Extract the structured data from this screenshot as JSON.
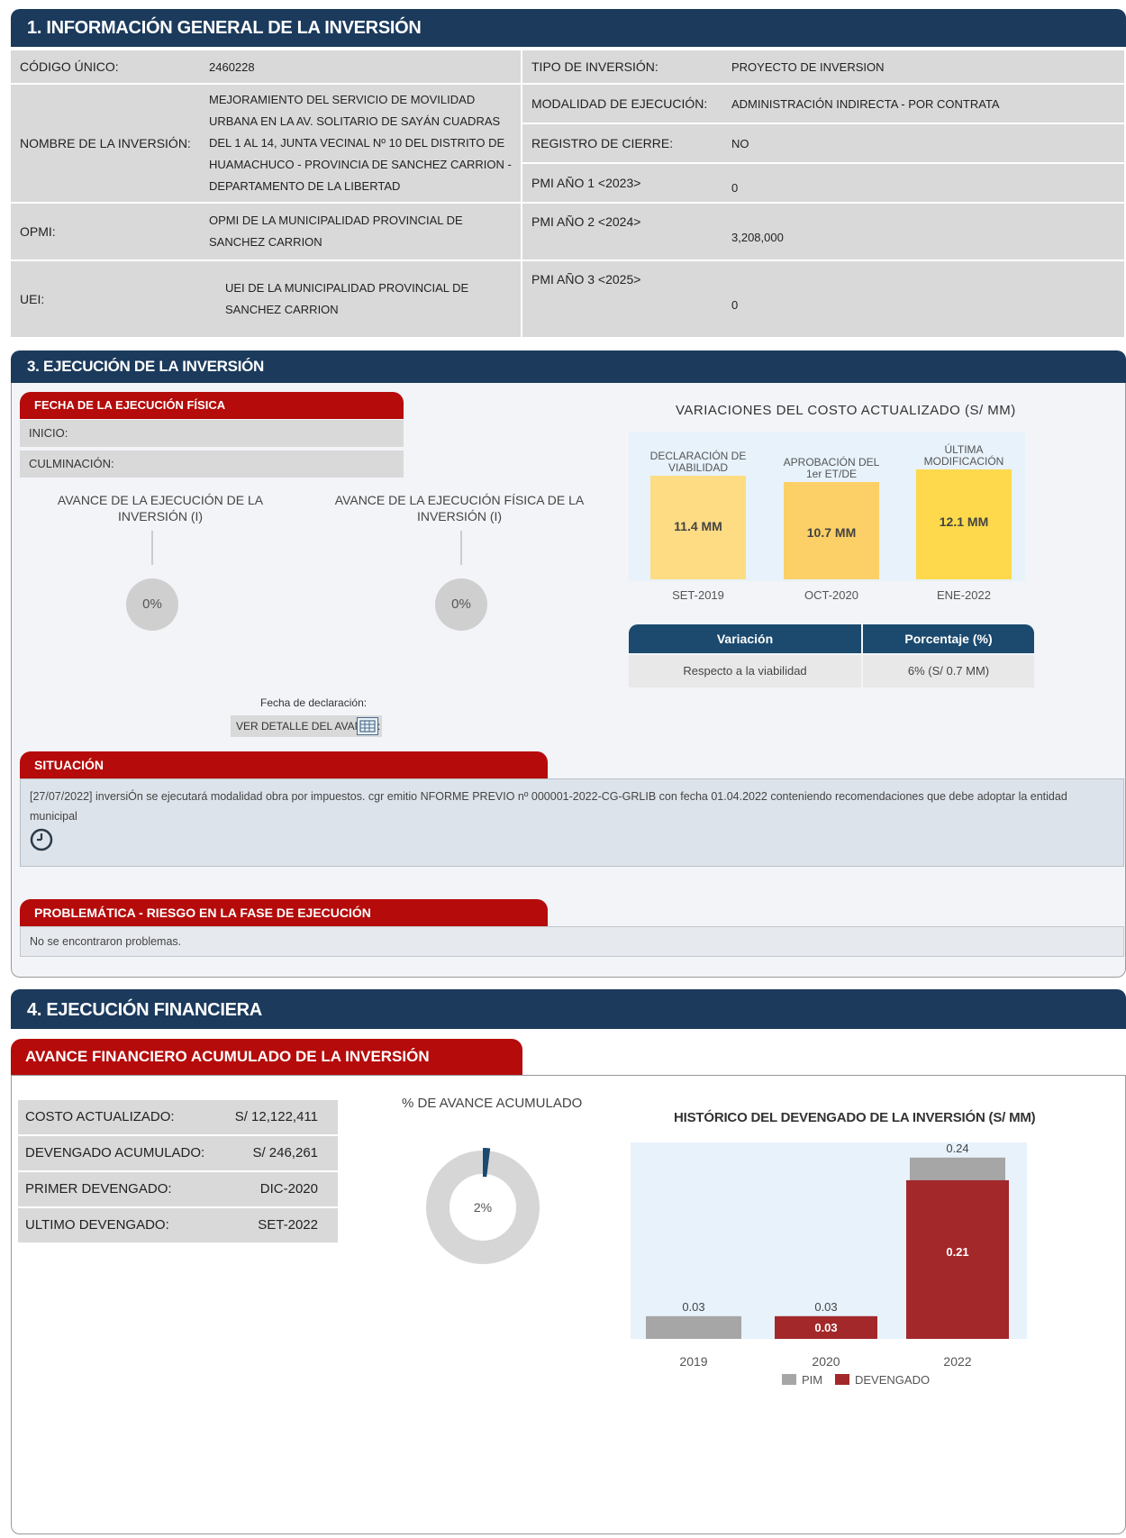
{
  "section1": {
    "title": "1. INFORMACIÓN GENERAL DE LA INVERSIÓN",
    "codigo_label": "CÓDIGO ÚNICO:",
    "codigo_value": "2460228",
    "nombre_label": "NOMBRE DE LA INVERSIÓN:",
    "nombre_value": "MEJORAMIENTO DEL SERVICIO DE MOVILIDAD URBANA EN LA AV. SOLITARIO DE SAYÁN CUADRAS DEL 1 AL 14, JUNTA VECINAL Nº 10 DEL DISTRITO DE HUAMACHUCO - PROVINCIA DE SANCHEZ CARRION - DEPARTAMENTO DE LA LIBERTAD",
    "opmi_label": "OPMI:",
    "opmi_value": "OPMI DE LA MUNICIPALIDAD PROVINCIAL DE SANCHEZ CARRION",
    "uei_label": "UEI:",
    "uei_value": "UEI DE LA MUNICIPALIDAD PROVINCIAL DE SANCHEZ CARRION",
    "tipo_label": "TIPO DE INVERSIÓN:",
    "tipo_value": "PROYECTO DE INVERSION",
    "modalidad_label": "MODALIDAD DE EJECUCIÓN:",
    "modalidad_value": "ADMINISTRACIÓN INDIRECTA - POR CONTRATA",
    "registro_label": "REGISTRO DE CIERRE:",
    "registro_value": "NO",
    "pmi1_label": "PMI AÑO 1 <2023>",
    "pmi1_value": "0",
    "pmi2_label": "PMI AÑO 2 <2024>",
    "pmi2_value": "3,208,000",
    "pmi3_label": "PMI AÑO 3 <2025>",
    "pmi3_value": "0"
  },
  "section3": {
    "title": "3. EJECUCIÓN DE LA INVERSIÓN",
    "fecha_tab": "FECHA DE LA EJECUCIÓN FÍSICA",
    "inicio_label": "INICIO:",
    "culminacion_label": "CULMINACIÓN:",
    "avance_inv_title": "AVANCE DE LA EJECUCIÓN DE LA INVERSIÓN (I)",
    "avance_inv_value": "0%",
    "avance_fis_title": "AVANCE DE LA EJECUCIÓN FÍSICA DE LA INVERSIÓN (I)",
    "avance_fis_value": "0%",
    "variaciones_title": "VARIACIONES DEL COSTO ACTUALIZADO (S/ MM)",
    "fecha_declaracion": "Fecha de declaración:",
    "ver_detalle": "VER DETALLE DEL AVANCE:",
    "variacion_header": "Variación",
    "porcentaje_header": "Porcentaje (%)",
    "variacion_row": "Respecto a la viabilidad",
    "porcentaje_row": "6% (S/ 0.7 MM)",
    "situacion_tab": "SITUACIÓN",
    "situacion_text": "[27/07/2022] inversiÓn se ejecutará modalidad obra por impuestos. cgr emitio NFORME PREVIO nº 000001-2022-CG-GRLIB con fecha 01.04.2022 conteniendo recomendaciones que debe adoptar la entidad municipal",
    "problematica_tab": "PROBLEMÁTICA - RIESGO EN LA FASE DE EJECUCIÓN",
    "problematica_text": "No se encontraron problemas."
  },
  "section4": {
    "title": "4. EJECUCIÓN FINANCIERA",
    "avance_tab": "AVANCE FINANCIERO ACUMULADO DE LA INVERSIÓN",
    "costo_label": "COSTO ACTUALIZADO:",
    "costo_value": "S/ 12,122,411",
    "devengado_label": "DEVENGADO ACUMULADO:",
    "devengado_value": "S/ 246,261",
    "primer_label": "PRIMER DEVENGADO:",
    "primer_value": "DIC-2020",
    "ultimo_label": "ULTIMO DEVENGADO:",
    "ultimo_value": "SET-2022",
    "donut_title": "% DE AVANCE ACUMULADO",
    "donut_value": "2%",
    "hist_title": "HISTÓRICO DEL DEVENGADO DE LA INVERSIÓN (S/ MM)"
  },
  "chart_data": [
    {
      "type": "bar",
      "title": "VARIACIONES DEL COSTO ACTUALIZADO (S/ MM)",
      "categories": [
        "DECLARACIÓN DE VIABILIDAD",
        "APROBACIÓN DEL 1er ET/DE",
        "ÚLTIMA MODIFICACIÓN"
      ],
      "dates": [
        "SET-2019",
        "OCT-2020",
        "ENE-2022"
      ],
      "values": [
        11.4,
        10.7,
        12.1
      ],
      "value_labels": [
        "11.4 MM",
        "10.7 MM",
        "12.1 MM"
      ],
      "colors": [
        "#fddc84",
        "#fcd067",
        "#fdd94b"
      ]
    },
    {
      "type": "donut",
      "title": "% DE AVANCE ACUMULADO",
      "values": [
        2
      ],
      "value_label": "2%",
      "colors": [
        "#1b4a6e",
        "#d6d6d6"
      ]
    },
    {
      "type": "bar",
      "title": "HISTÓRICO DEL DEVENGADO DE LA INVERSIÓN (S/ MM)",
      "categories": [
        "2019",
        "2020",
        "2022"
      ],
      "series": [
        {
          "name": "PIM",
          "values": [
            0.03,
            0.03,
            0.24
          ],
          "labels": [
            "0.03",
            "0.03",
            "0.24"
          ],
          "color": "#a6a6a6"
        },
        {
          "name": "DEVENGADO",
          "values": [
            0,
            0.03,
            0.21
          ],
          "labels": [
            "",
            "0.03",
            "0.21"
          ],
          "color": "#a3282a"
        }
      ],
      "ylim": [
        0,
        0.26
      ]
    }
  ]
}
